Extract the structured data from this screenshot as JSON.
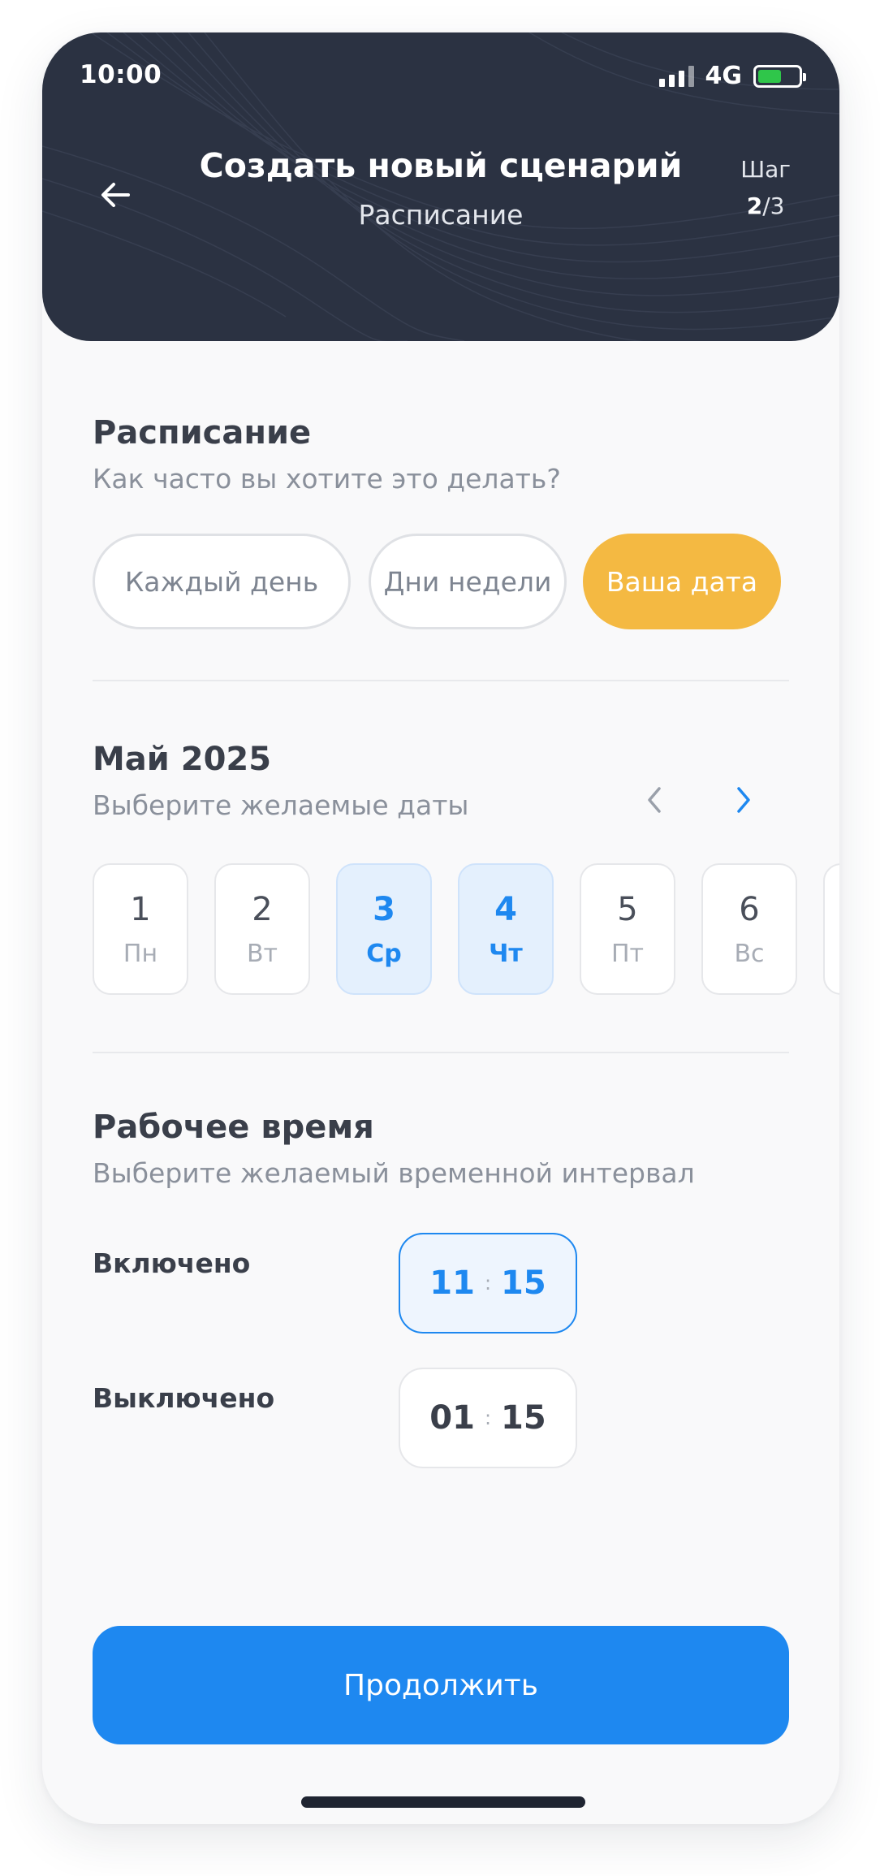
{
  "status": {
    "time": "10:00",
    "network": "4G"
  },
  "header": {
    "title": "Создать новый сценарий",
    "subtitle": "Расписание",
    "step_label": "Шаг",
    "step_current": "2",
    "step_total": "/3"
  },
  "schedule": {
    "title": "Расписание",
    "question": "Как часто вы хотите это делать?",
    "options": [
      {
        "label": "Каждый день",
        "selected": false
      },
      {
        "label": "Дни недели",
        "selected": false
      },
      {
        "label": "Ваша дата",
        "selected": true
      }
    ]
  },
  "calendar": {
    "month": "Май 2025",
    "hint": "Выберите желаемые даты",
    "days": [
      {
        "num": "1",
        "weekday": "Пн",
        "selected": false
      },
      {
        "num": "2",
        "weekday": "Вт",
        "selected": false
      },
      {
        "num": "3",
        "weekday": "Ср",
        "selected": true
      },
      {
        "num": "4",
        "weekday": "Чт",
        "selected": true
      },
      {
        "num": "5",
        "weekday": "Пт",
        "selected": false
      },
      {
        "num": "6",
        "weekday": "Вс",
        "selected": false
      }
    ]
  },
  "working_time": {
    "title": "Рабочее время",
    "hint": "Выберите желаемый временной интервал",
    "on": {
      "label": "Включено",
      "hours": "11",
      "minutes": "15"
    },
    "off": {
      "label": "Выключено",
      "hours": "01",
      "minutes": "15"
    }
  },
  "continue_label": "Продолжить",
  "colors": {
    "accent": "#1e88f0",
    "selected_option": "#f4b942",
    "header_bg": "#2b3242"
  }
}
